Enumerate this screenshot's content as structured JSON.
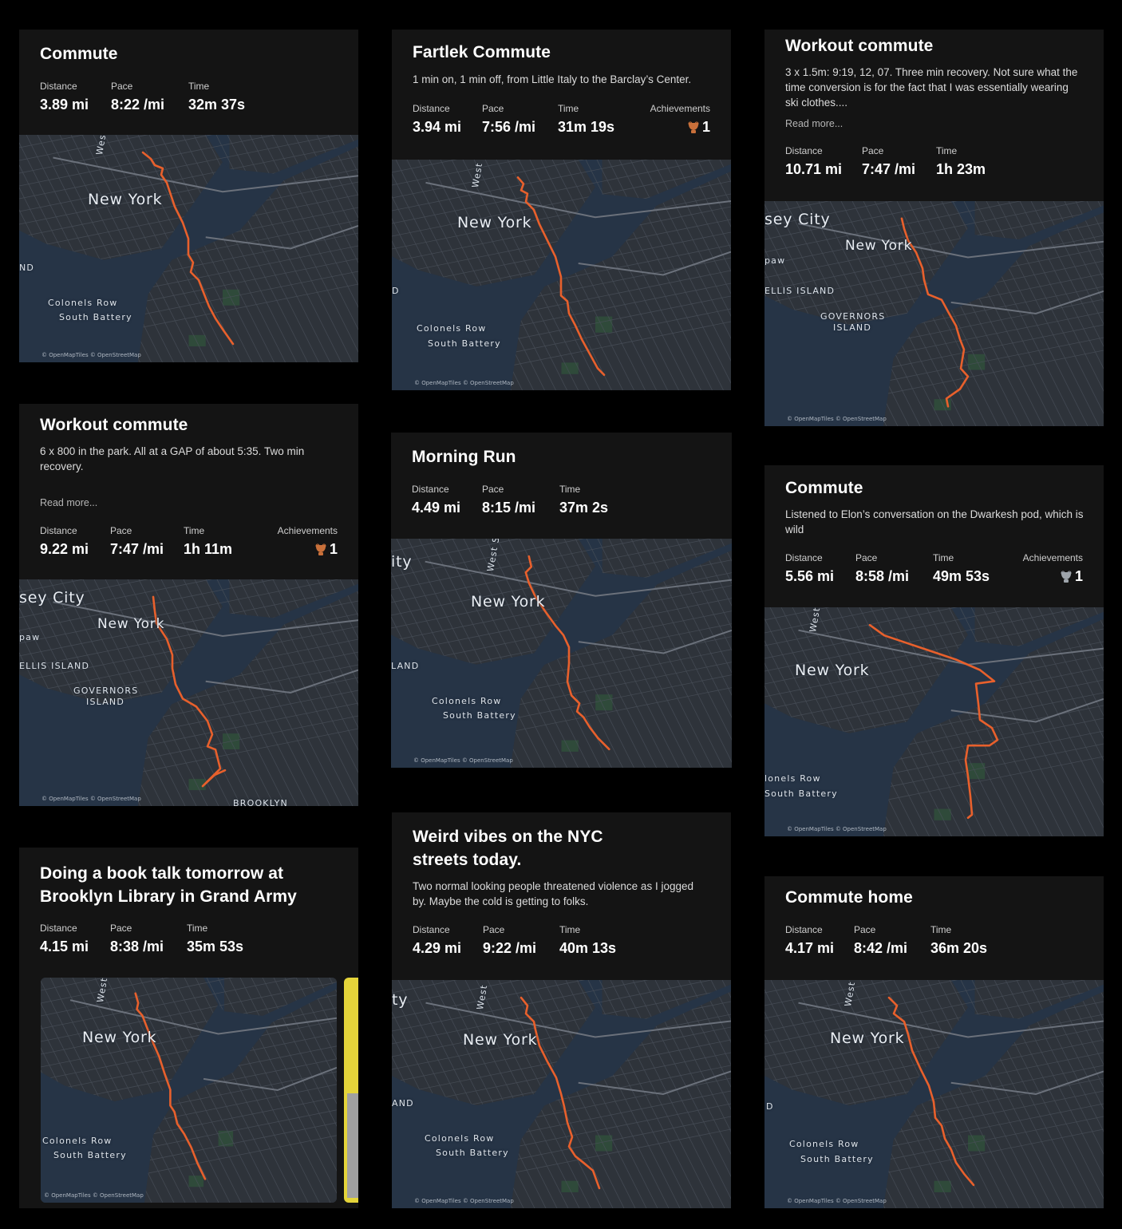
{
  "labels": {
    "distance": "Distance",
    "pace": "Pace",
    "time": "Time",
    "achievements": "Achievements"
  },
  "map": {
    "attribution": "© OpenMapTiles © OpenStreetMap",
    "route_color": "#e8602c",
    "water_color": "#263446",
    "land_color": "#2e333a"
  },
  "cards": [
    {
      "title": "Commute",
      "distance": "3.89 mi",
      "pace": "8:22 /mi",
      "time": "32m 37s",
      "map_labels": [
        "West S",
        "New York",
        "ND",
        "Colonels Row",
        "South Battery"
      ]
    },
    {
      "title": "Fartlek Commute",
      "description": "1 min on, 1 min off, from Little Italy to the Barclay’s Center.",
      "distance": "3.94 mi",
      "pace": "7:56 /mi",
      "time": "31m 19s",
      "achievements": "1",
      "map_labels": [
        "West",
        "New York",
        "D",
        "Colonels Row",
        "South Battery"
      ]
    },
    {
      "title": "Workout commute",
      "description": "3 x 1.5m: 9:19, 12, 07. Three min recovery. Not sure what the time conversion is for the fact that I was essentially wearing ski clothes....",
      "read_more": "Read more...",
      "distance": "10.71 mi",
      "pace": "7:47 /mi",
      "time": "1h 23m",
      "map_labels": [
        "sey City",
        "New York",
        "paw",
        "ELLIS ISLAND",
        "GOVERNORS",
        "ISLAND"
      ]
    },
    {
      "title": "Workout commute",
      "description": "6 x 800 in the park. All at a GAP of about 5:35. Two min recovery.",
      "read_more": "Read more...",
      "distance": "9.22 mi",
      "pace": "7:47 /mi",
      "time": "1h 11m",
      "achievements": "1",
      "map_labels": [
        "sey City",
        "New York",
        "paw",
        "ELLIS ISLAND",
        "GOVERNORS",
        "ISLAND",
        "BROOKLYN"
      ]
    },
    {
      "title": "Morning Run",
      "distance": "4.49 mi",
      "pace": "8:15 /mi",
      "time": "37m 2s",
      "map_labels": [
        "ity",
        "West S",
        "New York",
        "LAND",
        "Colonels Row",
        "South Battery"
      ]
    },
    {
      "title": "Commute",
      "description": "Listened to Elon’s conversation on the Dwarkesh pod, which is wild",
      "distance": "5.56 mi",
      "pace": "8:58 /mi",
      "time": "49m 53s",
      "achievements": "1",
      "map_labels": [
        "West",
        "New York",
        "lonels Row",
        "South Battery"
      ]
    },
    {
      "title": "Doing a book talk tomorrow at Brooklyn Library in Grand Army",
      "distance": "4.15 mi",
      "pace": "8:38 /mi",
      "time": "35m 53s",
      "map_labels": [
        "West",
        "New York",
        "Colonels Row",
        "South Battery"
      ]
    },
    {
      "title": "Weird vibes on the NYC streets today.",
      "description": "Two normal looking people threatened violence as I jogged by. Maybe the cold is getting to folks.",
      "distance": "4.29 mi",
      "pace": "9:22 /mi",
      "time": "40m 13s",
      "map_labels": [
        "ty",
        "West",
        "New York",
        "AND",
        "Colonels Row",
        "South Battery"
      ]
    },
    {
      "title": "Commute home",
      "distance": "4.17 mi",
      "pace": "8:42 /mi",
      "time": "36m 20s",
      "map_labels": [
        "West",
        "New York",
        "D",
        "Colonels Row",
        "South Battery"
      ]
    }
  ]
}
